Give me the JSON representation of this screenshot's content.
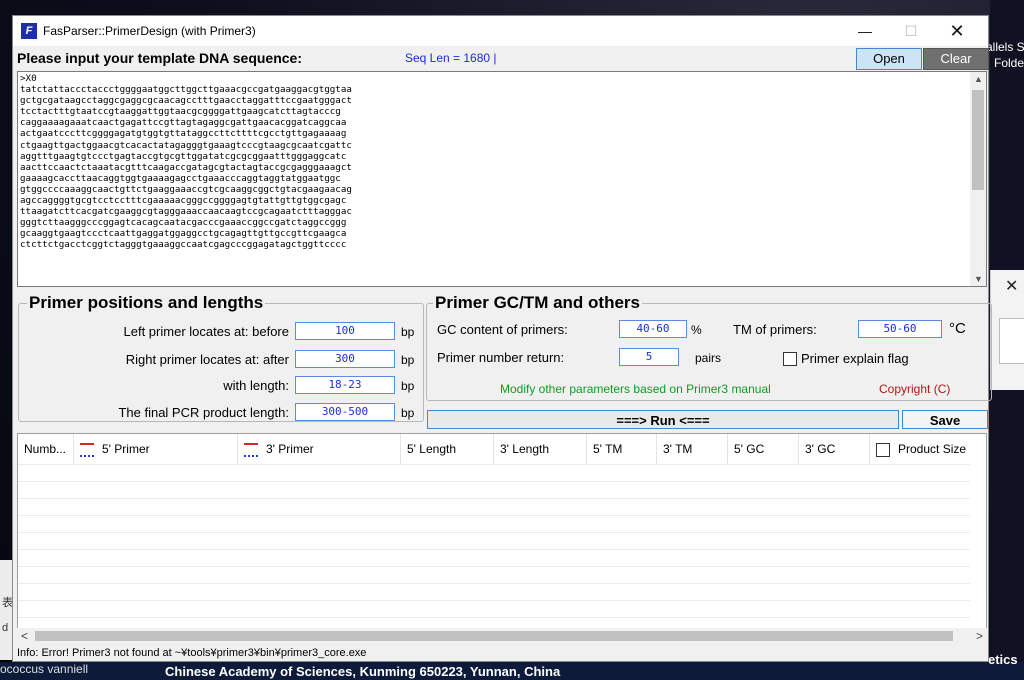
{
  "window": {
    "title": "FasParser::PrimerDesign (with Primer3)",
    "app_icon_glyph": "F",
    "minimize": "—",
    "maximize": "☐",
    "close": "✕"
  },
  "desktop": {
    "right_label_1": "allels S",
    "right_label_2": "Folde",
    "left_label_1": "表",
    "left_label_2": "d",
    "bottom_left": "ococcus vanniell",
    "bottom_center": "Chinese Academy of Sciences, Kunming 650223, Yunnan, China",
    "bottom_right": "etics",
    "side_close": "✕"
  },
  "header": {
    "prompt": "Please input your template DNA sequence:",
    "seq_len": "Seq Len = 1680 |",
    "open_label": "Open",
    "clear_label": "Clear"
  },
  "sequence": {
    "text": ">X0\ntatctattaccctaccctggggaatggcttggcttgaaacgccgatgaaggacgtggtaa\ngctgcgataagcctaggcgaggcgcaacagcctttgaacctaggatttccgaatgggact\ntcctactttgtaatccgtaaggattggtaacgcggggattgaagcatcttagtacccg\ncaggaaaagaaatcaactgagattccgttagtagaggcgattgaacacggatcaggcaa\nactgaatcccttcggggagatgtggtgttataggccttcttttcgcctgttgagaaaag\nctgaagttgactggaacgtcacactatagagggtgaaagtcccgtaagcgcaatcgattc\naggtttgaagtgtccctgagtaccgtgcgttggatatcgcgcggaatttgggaggcatc\naacttccaactctaaatacgtttcaagaccgatagcgtactagtaccgcgagggaaagct\ngaaaagcaccttaacaggtggtgaaaagagcctgaaacccaggtaggtatggaatggc\ngtggccccaaaggcaactgttctgaaggaaaccgtcgcaaggcggctgtacgaagaacag\nagccaggggtgcgtcctcctttcgaaaaacgggccggggagtgtattgttgtggcgagc\nttaagatcttcacgatcgaaggcgtagggaaaccaacaagtccgcagaatctttagggac\ngggtcttaagggcccggagtcacagcaatacgacccgaaaccggccgatctaggccggg\ngcaaggtgaagtccctcaattgaggatggaggcctgcagagttgttgccgttcgaagca\nctcttctgacctcggtctagggtgaaaggccaatcgagcccggagatagctggttcccc"
  },
  "positions": {
    "legend": "Primer positions and lengths",
    "left_label": "Left primer locates at: before",
    "left_value": "100",
    "right_label": "Right primer locates at: after",
    "right_value": "300",
    "length_label": "with length:",
    "length_value": "18-23",
    "product_label": "The final PCR product length:",
    "product_value": "300-500",
    "unit": "bp"
  },
  "gc_tm": {
    "legend": "Primer GC/TM and others",
    "gc_label": "GC content of primers:",
    "gc_value": "40-60",
    "gc_unit": "%",
    "tm_label": "TM of primers:",
    "tm_value": "50-60",
    "tm_unit": "°C",
    "num_label": "Primer number return:",
    "num_value": "5",
    "num_unit": "pairs",
    "explain_label": "Primer explain flag",
    "explain_checked": false,
    "modify_note": "Modify other parameters based on Primer3 manual",
    "copyright": "Copyright (C)"
  },
  "actions": {
    "run_label": "===> Run <===",
    "save_label": "Save"
  },
  "table": {
    "columns": [
      "Numb...",
      "5' Primer",
      "3' Primer",
      "5' Length",
      "3' Length",
      "5' TM",
      "3' TM",
      "5' GC",
      "3' GC",
      "Product Size"
    ],
    "rows": []
  },
  "hscroll": {
    "left": "<",
    "right": ">"
  },
  "status": "Info: Error! Primer3 not found at ~¥tools¥primer3¥bin¥primer3_core.exe"
}
